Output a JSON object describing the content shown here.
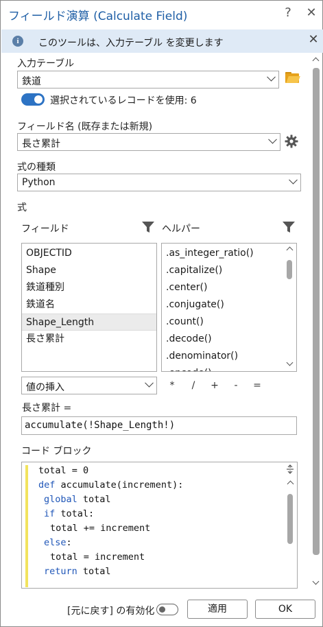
{
  "window": {
    "title": "フィールド演算 (Calculate Field)",
    "help_glyph": "?",
    "close_glyph": "✕"
  },
  "banner": {
    "message": "このツールは、入力テーブル を変更します",
    "icon": "info-icon",
    "close_glyph": "✕"
  },
  "input_table": {
    "label": "入力テーブル",
    "value": "鉄道",
    "browse_icon": "folder-icon"
  },
  "selection_toggle": {
    "label": "選択されているレコードを使用: 6",
    "on": true
  },
  "field_name": {
    "label": "フィールド名 (既存または新規)",
    "value": "長さ累計",
    "settings_icon": "gear-icon"
  },
  "expression_type": {
    "label": "式の種類",
    "value": "Python"
  },
  "expression": {
    "section_label": "式",
    "fields_header": "フィールド",
    "helpers_header": "ヘルパー",
    "fields": [
      "OBJECTID",
      "Shape",
      "鉄道種別",
      "鉄道名",
      "Shape_Length",
      "長さ累計"
    ],
    "selected_field_index": 4,
    "helpers": [
      ".as_integer_ratio()",
      ".capitalize()",
      ".center()",
      ".conjugate()",
      ".count()",
      ".decode()",
      ".denominator()",
      ".encode()"
    ],
    "insert_value_label": "値の挿入",
    "operators": [
      "*",
      "/",
      "+",
      "-",
      "="
    ],
    "target_label": "長さ累計 =",
    "expression_value": "accumulate(!Shape_Length!)"
  },
  "code_block": {
    "label": "コード ブロック",
    "lines": [
      {
        "kw": "",
        "text": "total = 0"
      },
      {
        "kw": "def",
        "text": " accumulate(increment):"
      },
      {
        "kw": "global",
        "text": " total"
      },
      {
        "kw": "if",
        "text": " total:"
      },
      {
        "kw": "",
        "text": "total += increment"
      },
      {
        "kw": "else",
        "text": ":"
      },
      {
        "kw": "",
        "text": "total = increment"
      },
      {
        "kw": "return",
        "text": " total"
      }
    ]
  },
  "footer": {
    "undo_label": "[元に戻す] の有効化",
    "undo_enabled": false,
    "apply_label": "適用",
    "ok_label": "OK"
  },
  "colors": {
    "title": "#1f5fa6",
    "banner_bg": "#dfeaf6",
    "toggle_on": "#2d73c4",
    "keyword": "#1f56b8",
    "code_gutter": "#f2e35e"
  }
}
